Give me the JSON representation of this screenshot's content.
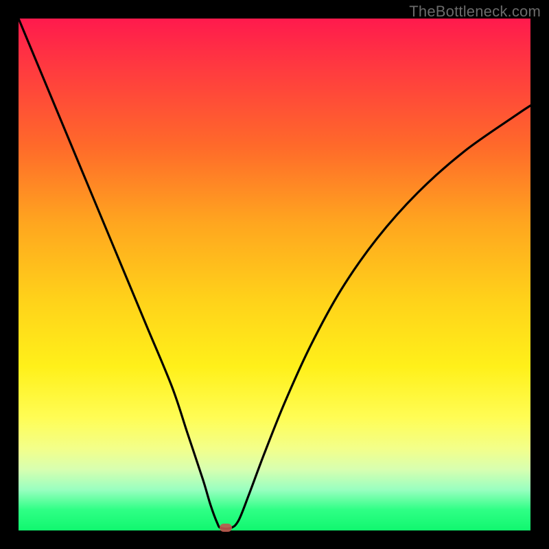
{
  "watermark": "TheBottleneck.com",
  "colors": {
    "frame": "#000000",
    "curve": "#000000",
    "marker": "#c0574f"
  },
  "chart_data": {
    "type": "line",
    "title": "",
    "xlabel": "",
    "ylabel": "",
    "xlim": [
      0,
      100
    ],
    "ylim": [
      0,
      100
    ],
    "grid": false,
    "legend": false,
    "series": [
      {
        "name": "bottleneck-curve",
        "x": [
          0,
          5,
          10,
          15,
          20,
          25,
          30,
          33,
          36,
          37.5,
          38.8,
          39.5,
          41.5,
          43,
          45,
          48,
          52,
          57,
          63,
          70,
          78,
          87,
          97,
          100
        ],
        "y": [
          100,
          88,
          76,
          64,
          52,
          40,
          28,
          19,
          10,
          5,
          1.5,
          0.5,
          0.5,
          2,
          7,
          15,
          25,
          36,
          47,
          57,
          66,
          74,
          81,
          83
        ]
      }
    ],
    "marker": {
      "x": 40.5,
      "y": 0.6
    },
    "gradient_stops": [
      {
        "pos": 0,
        "color": "#ff1a4d"
      },
      {
        "pos": 10,
        "color": "#ff3b3f"
      },
      {
        "pos": 25,
        "color": "#ff6a2a"
      },
      {
        "pos": 40,
        "color": "#ffa61f"
      },
      {
        "pos": 55,
        "color": "#ffd21a"
      },
      {
        "pos": 68,
        "color": "#fff01a"
      },
      {
        "pos": 78,
        "color": "#fffd55"
      },
      {
        "pos": 84,
        "color": "#f3ff8a"
      },
      {
        "pos": 88,
        "color": "#d8ffb0"
      },
      {
        "pos": 92,
        "color": "#9affc0"
      },
      {
        "pos": 96,
        "color": "#2eff85"
      },
      {
        "pos": 100,
        "color": "#11f76f"
      }
    ]
  }
}
